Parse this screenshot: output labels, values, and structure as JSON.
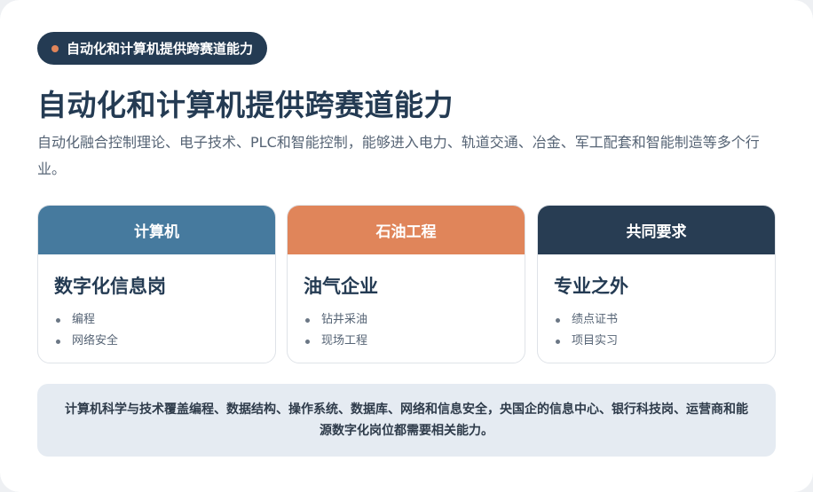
{
  "badge": {
    "label": "自动化和计算机提供跨赛道能力"
  },
  "heading": "自动化和计算机提供跨赛道能力",
  "description": "自动化融合控制理论、电子技术、PLC和智能控制，能够进入电力、轨道交通、冶金、军工配套和智能制造等多个行业。",
  "columns": [
    {
      "header": "计算机",
      "title": "数字化信息岗",
      "items": [
        "编程",
        "网络安全"
      ],
      "color": "#467a9e"
    },
    {
      "header": "石油工程",
      "title": "油气企业",
      "items": [
        "钻井采油",
        "现场工程"
      ],
      "color": "#e0855a"
    },
    {
      "header": "共同要求",
      "title": "专业之外",
      "items": [
        "绩点证书",
        "项目实习"
      ],
      "color": "#283d53"
    }
  ],
  "footer_note": "计算机科学与技术覆盖编程、数据结构、操作系统、数据库、网络和信息安全，央国企的信息中心、银行科技岗、运营商和能源数字化岗位都需要相关能力。"
}
